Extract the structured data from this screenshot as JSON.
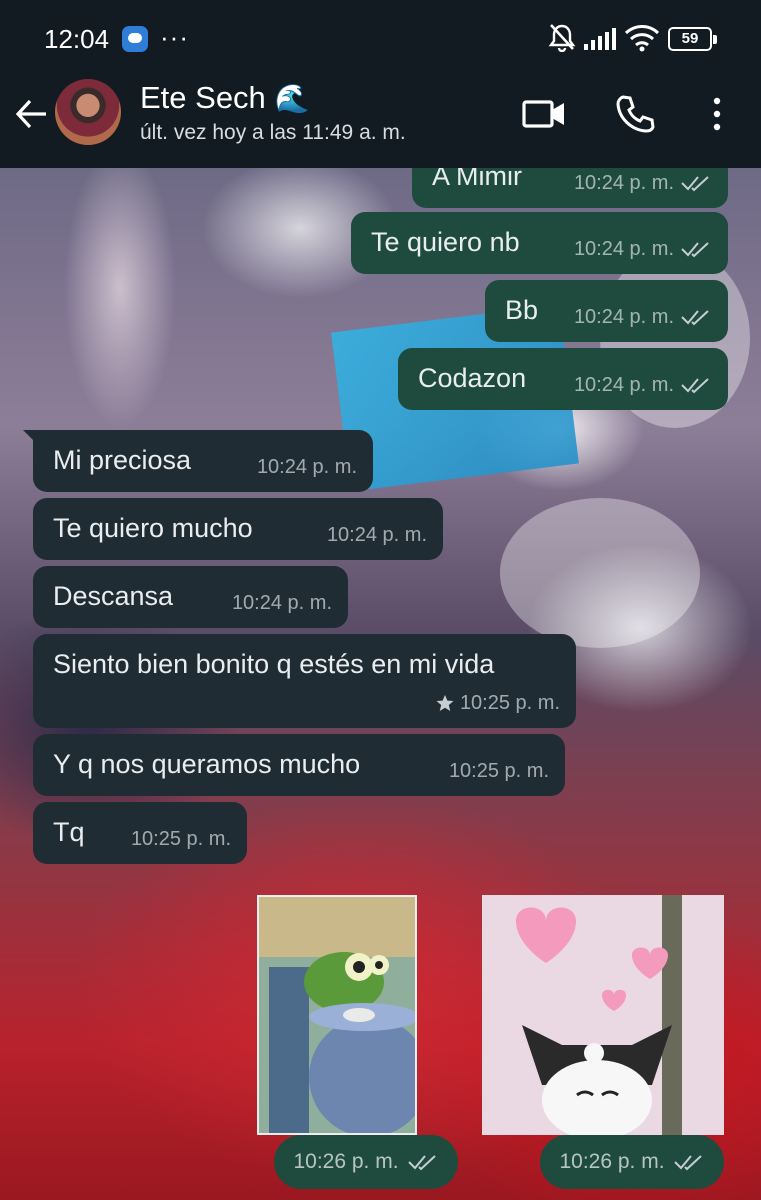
{
  "status_bar": {
    "time": "12:04",
    "dots": "···",
    "battery": "59"
  },
  "header": {
    "contact_name": "Ete Sech",
    "contact_emoji": "🌊",
    "last_seen": "últ. vez hoy a las 11:49 a. m."
  },
  "messages": [
    {
      "direction": "out",
      "text": "A Mimir",
      "time": "10:24 p. m."
    },
    {
      "direction": "out",
      "text": "Te quiero nb",
      "time": "10:24 p. m."
    },
    {
      "direction": "out",
      "text": "Bb",
      "time": "10:24 p. m."
    },
    {
      "direction": "out",
      "text": "Codazon",
      "time": "10:24 p. m."
    },
    {
      "direction": "in",
      "text": "Mi preciosa",
      "time": "10:24 p. m."
    },
    {
      "direction": "in",
      "text": "Te quiero mucho",
      "time": "10:24 p. m."
    },
    {
      "direction": "in",
      "text": "Descansa",
      "time": "10:24 p. m."
    },
    {
      "direction": "in",
      "text": "Siento bien bonito q estés en mi vida",
      "time": "10:25 p. m.",
      "starred": true
    },
    {
      "direction": "in",
      "text": "Y q nos queramos mucho",
      "time": "10:25 p. m."
    },
    {
      "direction": "in",
      "text": "Tq",
      "time": "10:25 p. m."
    }
  ],
  "stickers": [
    {
      "name": "frog-sticker",
      "time": "10:26 p. m."
    },
    {
      "name": "kuromi-sticker",
      "time": "10:26 p. m."
    }
  ],
  "colors": {
    "outgoing_bubble": "#1e4b3e",
    "incoming_bubble": "#1f2c34",
    "header_bg": "#121b22"
  }
}
